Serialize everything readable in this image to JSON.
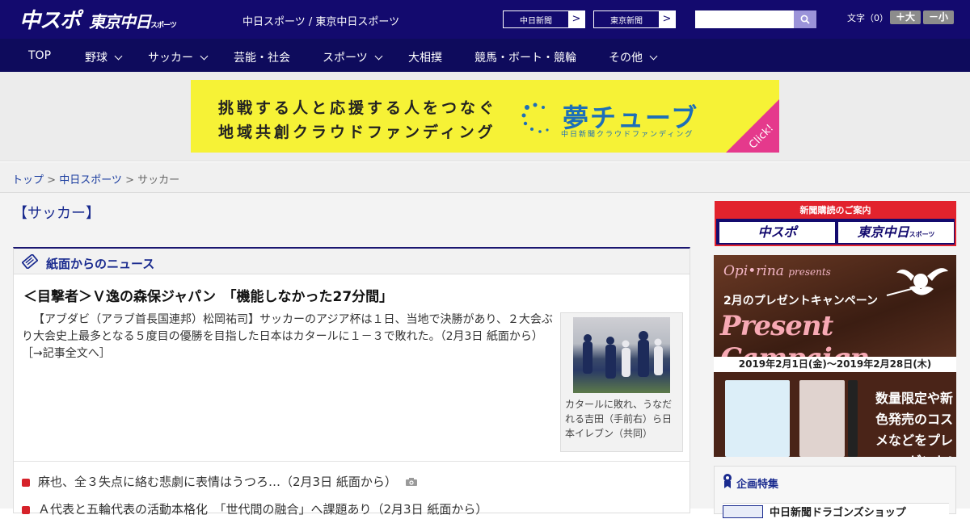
{
  "header": {
    "logo_chuspo": "中スポ",
    "logo_tokyo": "東京中日",
    "logo_tokyo_sub": "スポーツ",
    "site_title": "中日スポーツ / 東京中日スポーツ",
    "btn_chunichi": "中日新聞",
    "btn_tokyo": "東京新聞",
    "arrow": ">",
    "search": {
      "placeholder": "",
      "value": ""
    },
    "font_size_label": "文字（0）",
    "font_large": "＋大",
    "font_small": "－小"
  },
  "nav": {
    "items": [
      {
        "label": "TOP",
        "dropdown": false
      },
      {
        "label": "野球",
        "dropdown": true
      },
      {
        "label": "サッカー",
        "dropdown": true
      },
      {
        "label": "芸能・社会",
        "dropdown": false
      },
      {
        "label": "スポーツ",
        "dropdown": true
      },
      {
        "label": "大相撲",
        "dropdown": false
      },
      {
        "label": "競馬・ボート・競輪",
        "dropdown": false
      },
      {
        "label": "その他",
        "dropdown": true
      }
    ]
  },
  "banner": {
    "line1": "挑戦する人と応援する人をつなぐ",
    "line2": "地域共創クラウドファンディング",
    "logo": "夢チューブ",
    "sub": "中日新聞クラウドファンディング",
    "click": "Click!"
  },
  "breadcrumb": {
    "top": "トップ",
    "sep": " > ",
    "section": "中日スポーツ",
    "current": "サッカー"
  },
  "page_title": "【サッカー】",
  "news": {
    "heading": "紙面からのニュース",
    "lead": {
      "title": "＜目撃者＞Ｖ逸の森保ジャパン　「機能しなかった27分間」",
      "body": "【アブダビ（アラブ首長国連邦）松岡祐司】サッカーのアジア杯は１日、当地で決勝があり、２大会ぶり大会史上最多となる５度目の優勝を目指した日本はカタールに１－３で敗れた。（2月3日 紙面から）",
      "link": "［→記事全文へ］",
      "caption": "カタールに敗れ、うなだれる吉田（手前右）ら日本イレブン（共同）"
    },
    "items": [
      {
        "text": "麻也、全３失点に絡む悲劇に表情はうつろ…（2月3日 紙面から）",
        "has_photo": true
      },
      {
        "text": "Ａ代表と五輪代表の活動本格化　「世代間の融合」へ課題あり（2月3日 紙面から）",
        "has_photo": false
      }
    ]
  },
  "sidebar": {
    "subscribe_head": "新聞購読のご案内",
    "sub_chuspo": "中スポ",
    "sub_tokyo": "東京中日",
    "sub_tokyo_small": "スポーツ",
    "ad": {
      "brand": "Opi•rina",
      "brand_suffix": "presents",
      "heading": "2月のプレゼントキャンペーン",
      "campaign": "Present Campaign",
      "date": "2019年2月1日(金)～2019年2月28日(木)",
      "promo": "数量限定や新色発売のコスメなどをプレゼント!"
    },
    "feature_title": "企画特集",
    "feature_item": "中日新聞ドラゴンズショップ"
  },
  "colors": {
    "header_bg": "#130a6e",
    "nav_bg": "#0e0b5c",
    "accent_red": "#e2232d",
    "link_blue": "#1a3c9f"
  }
}
